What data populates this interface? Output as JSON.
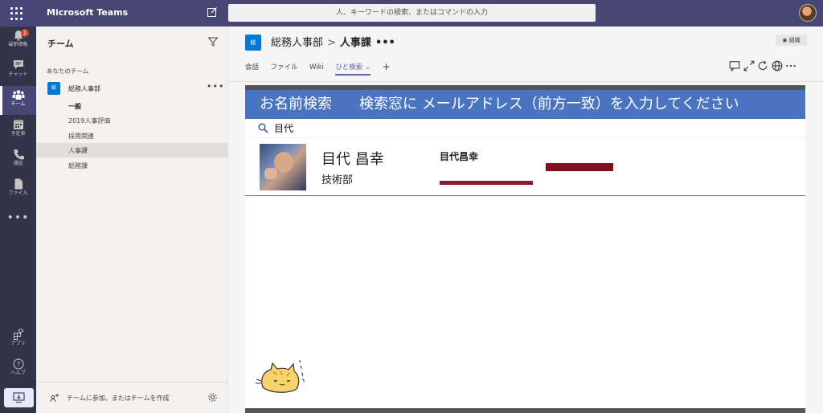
{
  "topbar": {
    "app_title": "Microsoft Teams",
    "search_placeholder": "人、キーワードの検索、またはコマンドの入力"
  },
  "rail": {
    "items": [
      {
        "label": "最新情報",
        "icon": "bell-icon",
        "badge": "1"
      },
      {
        "label": "チャット",
        "icon": "chat-icon"
      },
      {
        "label": "チーム",
        "icon": "teams-icon",
        "active": true
      },
      {
        "label": "予定表",
        "icon": "calendar-icon"
      },
      {
        "label": "通話",
        "icon": "phone-icon"
      },
      {
        "label": "ファイル",
        "icon": "file-icon"
      }
    ],
    "more": "•••",
    "bottom_items": [
      {
        "label": "アプリ",
        "icon": "apps-icon"
      },
      {
        "label": "ヘルプ",
        "icon": "help-icon"
      }
    ]
  },
  "panel": {
    "title": "チーム",
    "section_title": "あなたのチーム",
    "team": {
      "avatar": "総",
      "name": "総務人事部",
      "more": "•••"
    },
    "channels": [
      "一般",
      "2019人事評価",
      "採用関連",
      "人事課",
      "総務課"
    ],
    "footer_text": "チームに参加、またはチームを作成"
  },
  "main": {
    "channel_avatar": "総",
    "breadcrumb": {
      "team": "総務人事部",
      "separator": ">",
      "channel": "人事課",
      "more": "•••"
    },
    "org_button": "組織",
    "tabs": [
      "会話",
      "ファイル",
      "Wiki",
      "ひと検索"
    ],
    "active_tab": "ひと検索",
    "add_tab": "+"
  },
  "app": {
    "banner_title": "お名前検索",
    "banner_instruction": "検索窓に メールアドレス（前方一致）を入力してください",
    "search_value": "目代",
    "result": {
      "name": "目代 昌幸",
      "department": "技術部",
      "name_compact": "目代昌幸"
    }
  },
  "colors": {
    "topbar": "#464775",
    "rail": "#33344a",
    "accent": "#6264a7",
    "banner": "#4a74bf",
    "badge": "#cc4a31",
    "team_avatar": "#0078d4"
  }
}
